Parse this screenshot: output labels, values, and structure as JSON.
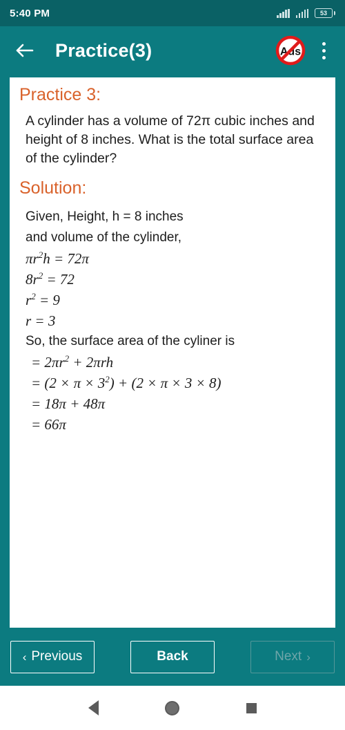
{
  "status_bar": {
    "time": "5:40 PM",
    "battery_level": "53",
    "signal_icon_1": "signal-bars-icon",
    "signal_icon_2": "signal-bars-icon",
    "battery_icon": "battery-icon"
  },
  "app_bar": {
    "back_icon": "back-arrow-icon",
    "title": "Practice(3)",
    "ads_badge_label": "Ads",
    "ads_badge_icon": "no-ads-icon",
    "overflow_icon": "kebab-menu-icon"
  },
  "content": {
    "practice_heading": "Practice 3:",
    "question": "A cylinder has a volume of 72π cubic inches and height of 8 inches. What is the total surface area of the cylinder?",
    "solution_heading": "Solution:",
    "solution_lines": [
      "Given, Height, h = 8 inches",
      "and volume of the cylinder,",
      "πr²h = 72π",
      "8r² = 72",
      "r² = 9",
      "r = 3",
      "So, the surface area of the cyliner is",
      "= 2πr² + 2πrh",
      "= (2 × π × 3²) + (2 × π × 3 × 8)",
      "= 18π + 48π",
      "= 66π"
    ]
  },
  "footer": {
    "previous_label": "Previous",
    "previous_chevron": "‹",
    "back_label": "Back",
    "next_label": "Next",
    "next_chevron": "›",
    "next_disabled": "true"
  },
  "system_nav": {
    "back_icon": "android-back-icon",
    "home_icon": "android-home-icon",
    "recents_icon": "android-recents-icon"
  },
  "colors": {
    "app_bar": "#0c7b80",
    "status_bar": "#0a6165",
    "heading": "#d9622b",
    "card": "#ffffff",
    "disabled": "#6fa6a9"
  }
}
